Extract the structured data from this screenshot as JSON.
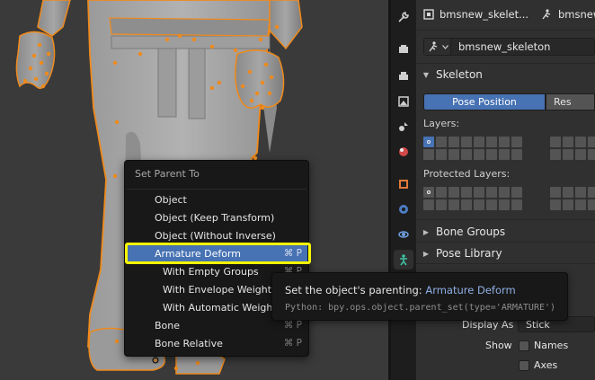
{
  "viewport": {},
  "properties": {
    "header": {
      "object_name": "bmsnew_skelet...",
      "armature_name": "bmsnew",
      "pin_icon": "pin-icon"
    },
    "datablock_name": "bmsnew_skeleton",
    "skeleton": {
      "title": "Skeleton",
      "pose_position_label": "Pose Position",
      "rest_position_label": "Res",
      "layers_label": "Layers:",
      "protected_layers_label": "Protected Layers:"
    },
    "panels": {
      "bone_groups": "Bone Groups",
      "pose_library": "Pose Library"
    },
    "viewport_display": {
      "display_as_label": "Display As",
      "display_as_value": "Stick",
      "show_label": "Show",
      "names_label": "Names",
      "axes_label": "Axes"
    }
  },
  "menu": {
    "title": "Set Parent To",
    "items": [
      {
        "label": "Object",
        "shortcut": ""
      },
      {
        "label": "Object (Keep Transform)",
        "shortcut": ""
      },
      {
        "label": "Object (Without Inverse)",
        "shortcut": ""
      },
      {
        "label": "Armature Deform",
        "shortcut": "⌘ P"
      },
      {
        "label": "With Empty Groups",
        "shortcut": "⌘ P"
      },
      {
        "label": "With Envelope Weights",
        "shortcut": ""
      },
      {
        "label": "With Automatic Weights",
        "shortcut": ""
      },
      {
        "label": "Bone",
        "shortcut": "⌘ P"
      },
      {
        "label": "Bone Relative",
        "shortcut": "⌘ P"
      }
    ]
  },
  "tooltip": {
    "description_prefix": "Set the object's parenting:",
    "description_value": "Armature Deform",
    "python": "Python: bpy.ops.object.parent_set(type='ARMATURE')"
  },
  "colors": {
    "accent": "#4772b3",
    "highlight_outline": "#f7f700",
    "selection_orange": "#f08a1c"
  }
}
